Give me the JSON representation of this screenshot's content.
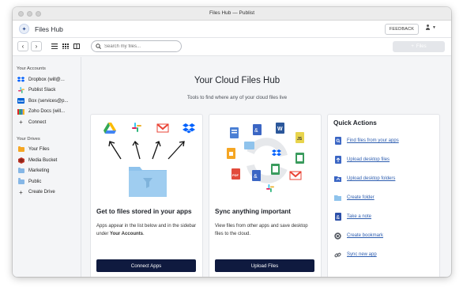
{
  "window_title": "Files Hub — Publist",
  "app_name": "Files Hub",
  "feedback_label": "FEEDBACK",
  "search": {
    "placeholder": "Search my files..."
  },
  "files_button": "Files",
  "sidebar": {
    "accounts_heading": "Your Accounts",
    "accounts": [
      {
        "label": "Dropbox (will@...",
        "icon": "dropbox-icon",
        "color": "#0061fe"
      },
      {
        "label": "Publist Slack",
        "icon": "slack-icon",
        "color": "#e01e5a"
      },
      {
        "label": "Box (services@p...",
        "icon": "box-icon",
        "color": "#0061d5"
      },
      {
        "label": "Zoho Docs (will...",
        "icon": "zoho-icon",
        "color": "#e42527"
      }
    ],
    "connect_label": "Connect",
    "drives_heading": "Your Drives",
    "drives": [
      {
        "label": "Your Files",
        "color": "#f5a623"
      },
      {
        "label": "Media Bucket",
        "color": "#c0392b"
      },
      {
        "label": "Marketing",
        "color": "#86b7e6"
      },
      {
        "label": "Public",
        "color": "#86b7e6"
      }
    ],
    "create_drive_label": "Create Drive"
  },
  "hero": {
    "title": "Your Cloud Files Hub",
    "subtitle": "Tools to find where any of your cloud files live"
  },
  "card1": {
    "title": "Get to files stored in your apps",
    "body_part1": "Apps appear in the list below and in the sidebar under ",
    "body_bold": "Your Accounts",
    "body_part2": ".",
    "button": "Connect Apps"
  },
  "card2": {
    "title": "Sync anything important",
    "body": "View files from other apps and save desktop files to the cloud.",
    "button": "Upload Files"
  },
  "quick_actions": {
    "title": "Quick Actions",
    "items": [
      {
        "label": "Find files from your apps",
        "icon": "find-files-icon"
      },
      {
        "label": "Upload desktop files",
        "icon": "upload-file-icon"
      },
      {
        "label": "Upload desktop folders",
        "icon": "upload-folder-icon"
      },
      {
        "label": "Create folder",
        "icon": "folder-icon"
      },
      {
        "label": "Take a note",
        "icon": "note-icon"
      },
      {
        "label": "Create bookmark",
        "icon": "bookmark-icon"
      },
      {
        "label": "Sync new app",
        "icon": "link-icon"
      }
    ]
  },
  "colors": {
    "accent_dark": "#0f1a3f",
    "link": "#2e5eb0",
    "folder_blue": "#8fc3ec"
  }
}
